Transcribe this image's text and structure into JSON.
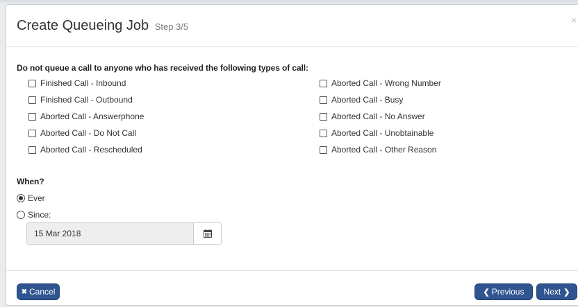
{
  "modal": {
    "title": "Create Queueing Job",
    "step": "Step 3/5",
    "close_icon": "×"
  },
  "exclusions": {
    "heading": "Do not queue a call to anyone who has received the following types of call:",
    "left": [
      {
        "label": "Finished Call - Inbound",
        "checked": false
      },
      {
        "label": "Finished Call - Outbound",
        "checked": false
      },
      {
        "label": "Aborted Call - Answerphone",
        "checked": false
      },
      {
        "label": "Aborted Call - Do Not Call",
        "checked": false
      },
      {
        "label": "Aborted Call - Rescheduled",
        "checked": false
      }
    ],
    "right": [
      {
        "label": "Aborted Call - Wrong Number",
        "checked": false
      },
      {
        "label": "Aborted Call - Busy",
        "checked": false
      },
      {
        "label": "Aborted Call - No Answer",
        "checked": false
      },
      {
        "label": "Aborted Call - Unobtainable",
        "checked": false
      },
      {
        "label": "Aborted Call - Other Reason",
        "checked": false
      }
    ]
  },
  "when": {
    "heading": "When?",
    "ever_label": "Ever",
    "since_label": "Since:",
    "selected": "ever",
    "since_date": "15 Mar 2018",
    "calendar_icon": "calendar-icon"
  },
  "footer": {
    "cancel_label": "Cancel",
    "cancel_icon": "✖",
    "previous_label": "Previous",
    "previous_icon": "❮",
    "next_label": "Next",
    "next_icon": "❯"
  },
  "colors": {
    "button_bg": "#2f5490",
    "date_bg": "#eeeeee"
  }
}
